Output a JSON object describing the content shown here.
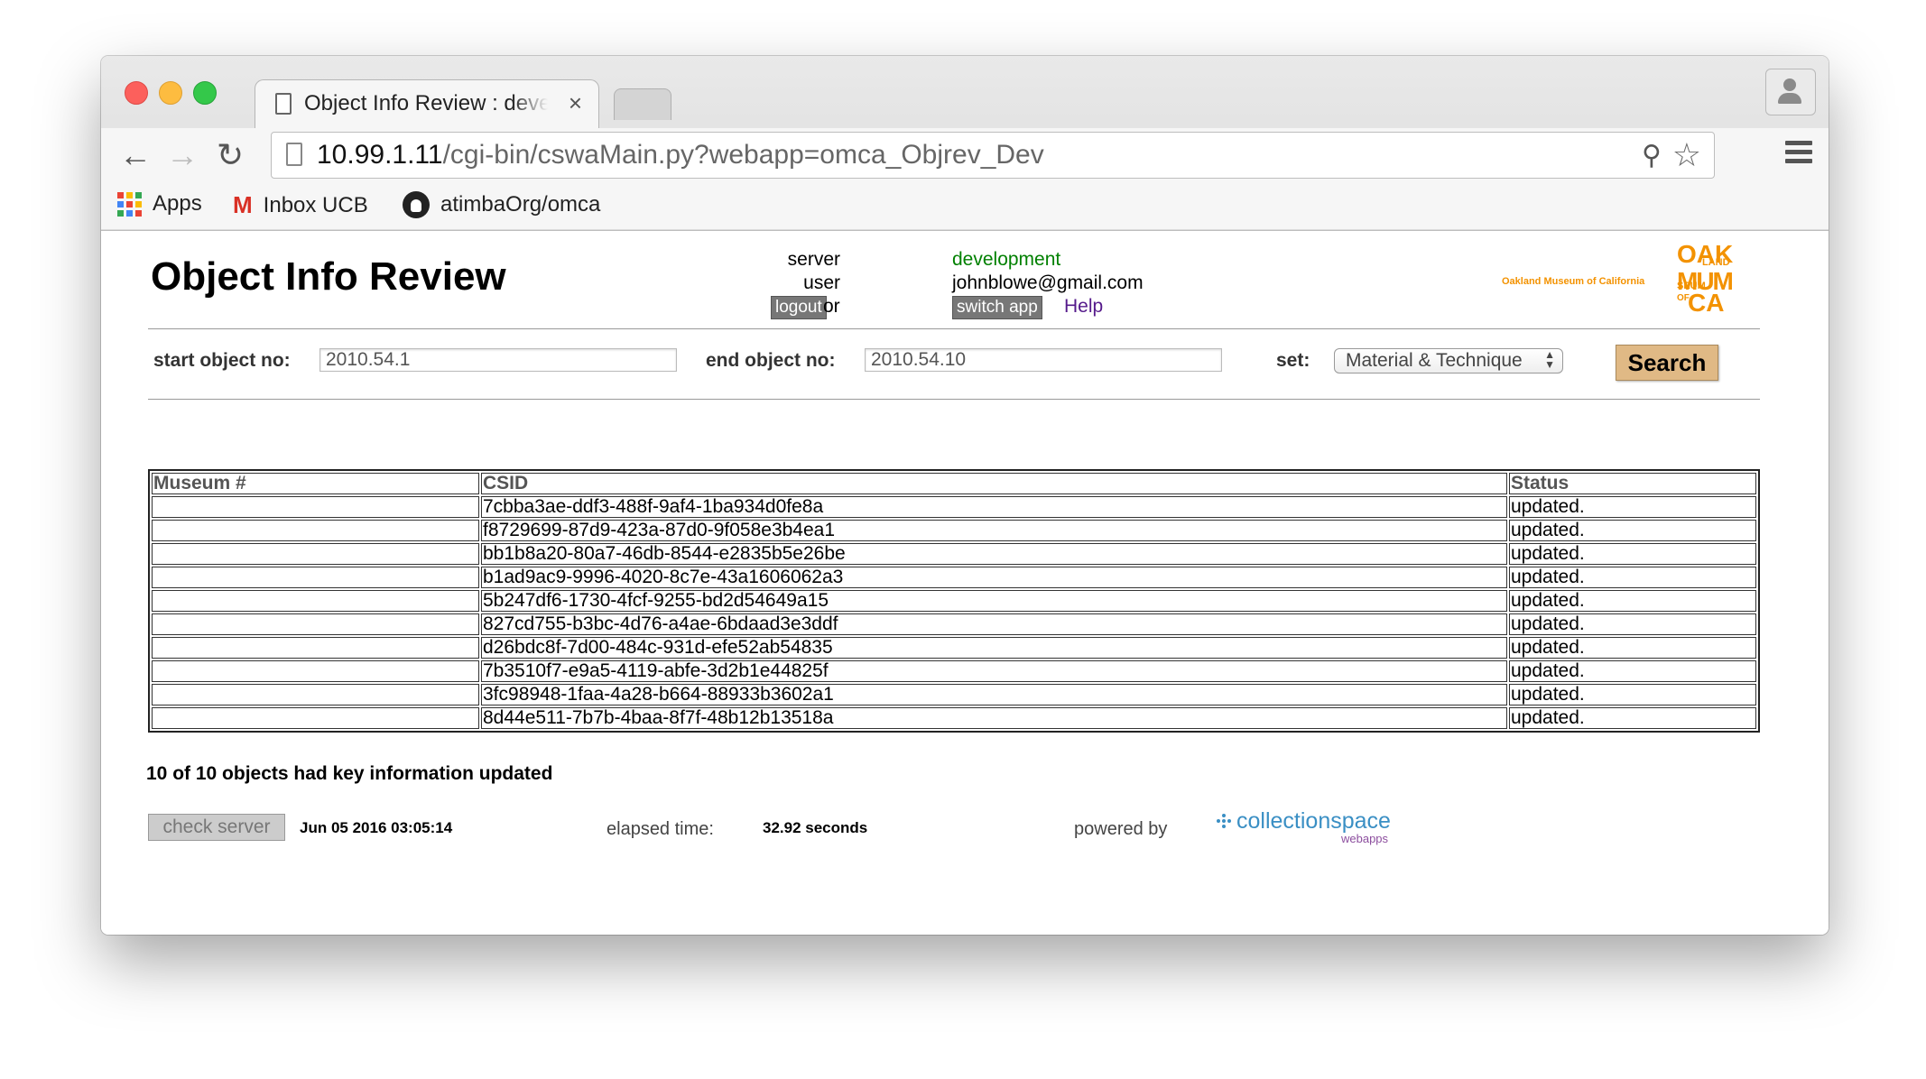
{
  "browser": {
    "tab_title": "Object Info Review : development",
    "tab_close": "×",
    "url_host": "10.99.1.11",
    "url_path": "/cgi-bin/cswaMain.py?webapp=omca_Objrev_Dev",
    "bookmarks": [
      {
        "label": "Apps",
        "icon": "apps-grid-icon"
      },
      {
        "label": "Inbox UCB",
        "icon": "gmail-icon"
      },
      {
        "label": "atimbaOrg/omca",
        "icon": "github-icon"
      }
    ]
  },
  "header": {
    "title": "Object Info Review",
    "server_label": "server",
    "server_value": "development",
    "user_label": "user",
    "user_value": "johnblowe@gmail.com",
    "logout": "logout",
    "or": "or",
    "switch_app": "switch app",
    "help": "Help",
    "museum_name": "Oakland Museum of California",
    "logo_lines": [
      "OAK",
      "LAND",
      "MUM",
      "SEUM",
      "OF",
      "CA"
    ]
  },
  "form": {
    "start_label": "start object no:",
    "start_value": "2010.54.1",
    "end_label": "end object no:",
    "end_value": "2010.54.10",
    "set_label": "set:",
    "set_value": "Material & Technique",
    "search_button": "Search"
  },
  "table": {
    "headers": [
      "Museum #",
      "CSID",
      "Status"
    ],
    "rows": [
      [
        "",
        "7cbba3ae-ddf3-488f-9af4-1ba934d0fe8a",
        "updated."
      ],
      [
        "",
        "f8729699-87d9-423a-87d0-9f058e3b4ea1",
        "updated."
      ],
      [
        "",
        "bb1b8a20-80a7-46db-8544-e2835b5e26be",
        "updated."
      ],
      [
        "",
        "b1ad9ac9-9996-4020-8c7e-43a1606062a3",
        "updated."
      ],
      [
        "",
        "5b247df6-1730-4fcf-9255-bd2d54649a15",
        "updated."
      ],
      [
        "",
        "827cd755-b3bc-4d76-a4ae-6bdaad3e3ddf",
        "updated."
      ],
      [
        "",
        "d26bdc8f-7d00-484c-931d-efe52ab54835",
        "updated."
      ],
      [
        "",
        "7b3510f7-e9a5-4119-abfe-3d2b1e44825f",
        "updated."
      ],
      [
        "",
        "3fc98948-1faa-4a28-b664-88933b3602a1",
        "updated."
      ],
      [
        "",
        "8d44e511-7b7b-4baa-8f7f-48b12b13518a",
        "updated."
      ]
    ]
  },
  "summary": "10 of 10 objects had key information updated",
  "footer": {
    "check_server": "check server",
    "date": "Jun 05 2016 03:05:14",
    "elapsed_label": "elapsed time:",
    "elapsed_value": "32.92 seconds",
    "powered_by": "powered by",
    "brand": "collectionspace",
    "brand_sub": "webapps"
  },
  "colors": {
    "server_value": "#008000",
    "help_link": "#551a8b",
    "search_button": "#e0b985",
    "omca_orange": "#f39200",
    "collectionspace_blue": "#3a8fc4"
  }
}
